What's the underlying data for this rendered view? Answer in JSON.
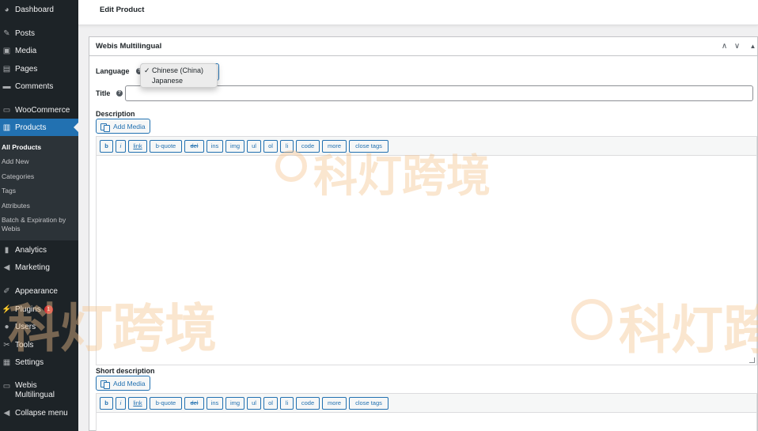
{
  "sidebar": {
    "items": [
      {
        "label": "Dashboard",
        "icon": "dashboard-icon",
        "glyph": "◕"
      },
      {
        "label": "Posts",
        "icon": "pin-icon",
        "glyph": "✎"
      },
      {
        "label": "Media",
        "icon": "media-icon",
        "glyph": "▣"
      },
      {
        "label": "Pages",
        "icon": "pages-icon",
        "glyph": "▤"
      },
      {
        "label": "Comments",
        "icon": "comments-icon",
        "glyph": "▬"
      },
      {
        "label": "WooCommerce",
        "icon": "woocommerce-icon",
        "glyph": "▭"
      },
      {
        "label": "Products",
        "icon": "products-icon",
        "glyph": "▥"
      },
      {
        "label": "Analytics",
        "icon": "analytics-icon",
        "glyph": "▮"
      },
      {
        "label": "Marketing",
        "icon": "megaphone-icon",
        "glyph": "◀"
      },
      {
        "label": "Appearance",
        "icon": "brush-icon",
        "glyph": "✐"
      },
      {
        "label": "Plugins",
        "icon": "plug-icon",
        "glyph": "⚡",
        "badge": "1"
      },
      {
        "label": "Users",
        "icon": "users-icon",
        "glyph": "●"
      },
      {
        "label": "Tools",
        "icon": "wrench-icon",
        "glyph": "✂"
      },
      {
        "label": "Settings",
        "icon": "settings-icon",
        "glyph": "▦"
      },
      {
        "label": "Webis Multilingual",
        "icon": "translate-icon",
        "glyph": "▭"
      },
      {
        "label": "Collapse menu",
        "icon": "collapse-icon",
        "glyph": "◀"
      }
    ],
    "submenu": [
      "All Products",
      "Add New",
      "Categories",
      "Tags",
      "Attributes",
      "Batch & Expiration by Webis"
    ]
  },
  "header": {
    "title": "Edit Product"
  },
  "metabox": {
    "title": "Webis Multilingual",
    "language_label": "Language",
    "language_options": [
      "Chinese (China)",
      "Japanese"
    ],
    "selected_mark": "✓",
    "title_label": "Title",
    "title_value": "",
    "description_label": "Description",
    "short_description_label": "Short description",
    "add_media_label": "Add Media",
    "quicktags": [
      "b",
      "i",
      "link",
      "b-quote",
      "del",
      "ins",
      "img",
      "ul",
      "ol",
      "li",
      "code",
      "more",
      "close tags"
    ],
    "editor_content": ""
  },
  "watermark": {
    "text": "科灯跨境"
  },
  "colors": {
    "sidebar": "#1d2327",
    "active": "#2271b1",
    "watermark": "#f5c48e"
  }
}
